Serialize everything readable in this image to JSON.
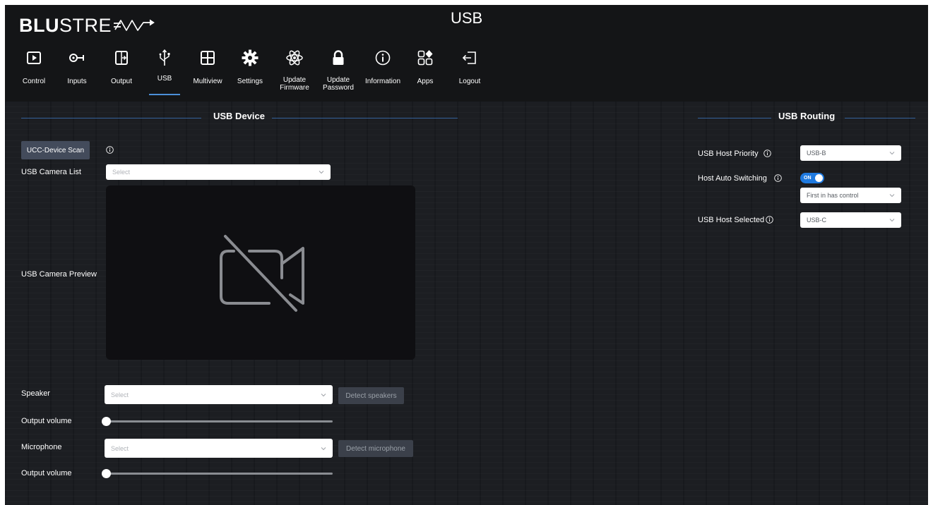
{
  "brand": {
    "logo_bold": "BLU",
    "logo_thin": "STRE"
  },
  "page": {
    "title": "USB"
  },
  "nav": {
    "items": [
      {
        "label": "Control",
        "icon": "play-screen-icon"
      },
      {
        "label": "Inputs",
        "icon": "input-plug-icon"
      },
      {
        "label": "Output",
        "icon": "output-arrow-icon"
      },
      {
        "label": "USB",
        "icon": "usb-icon",
        "active": true
      },
      {
        "label": "Multiview",
        "icon": "grid-icon"
      },
      {
        "label": "Settings",
        "icon": "gear-icon"
      },
      {
        "label": "Update\nFirmware",
        "icon": "atom-icon"
      },
      {
        "label": "Update\nPassword",
        "icon": "lock-icon"
      },
      {
        "label": "Information",
        "icon": "info-icon"
      },
      {
        "label": "Apps",
        "icon": "apps-icon"
      },
      {
        "label": "Logout",
        "icon": "logout-icon"
      }
    ]
  },
  "usb_device": {
    "title": "USB Device",
    "scan_button": "UCC-Device Scan",
    "camera_list_label": "USB Camera List",
    "camera_list_value": "Select",
    "camera_preview_label": "USB Camera Preview",
    "speaker_label": "Speaker",
    "speaker_value": "Select",
    "detect_speakers": "Detect speakers",
    "output_volume_label": "Output volume",
    "speaker_volume": 0,
    "microphone_label": "Microphone",
    "microphone_value": "Select",
    "detect_microphone": "Detect microphone",
    "output_volume_label_2": "Output volume",
    "microphone_volume": 0
  },
  "usb_routing": {
    "title": "USB Routing",
    "host_priority_label": "USB Host Priority",
    "host_priority_value": "USB-B",
    "auto_switching_label": "Host Auto Switching",
    "auto_switching_state": "ON",
    "auto_switching_mode": "First in has control",
    "host_selected_label": "USB Host Selected",
    "host_selected_value": "USB-C"
  },
  "colors": {
    "accent": "#1f7ae0",
    "section_line": "#35629b",
    "background": "#1c1e22",
    "header": "#141517",
    "button": "#434b5b"
  }
}
